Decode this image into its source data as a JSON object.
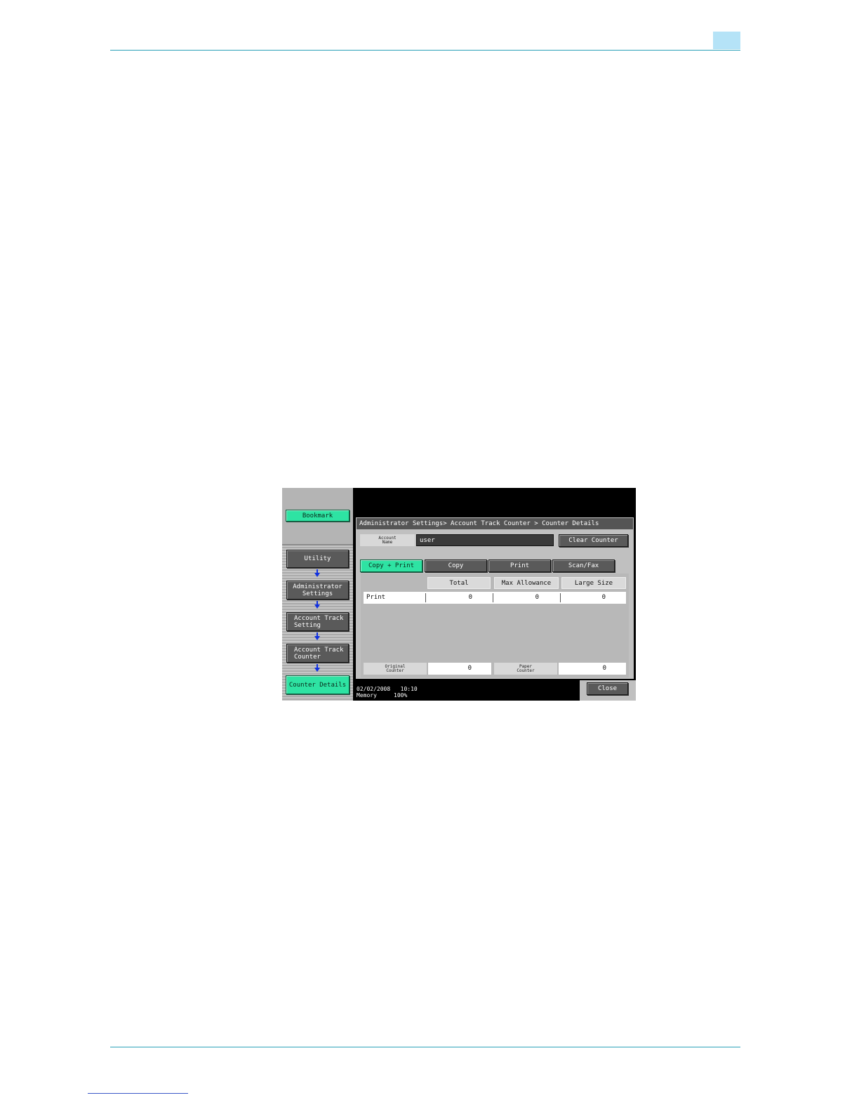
{
  "screen": {
    "sidebar": {
      "bookmark_label": "Bookmark",
      "utility_label": "Utility",
      "admin_settings_label": "Administrator\nSettings",
      "account_track_setting_label": "Account Track\nSetting",
      "account_track_counter_label": "Account Track\nCounter",
      "counter_details_label": "Counter Details"
    },
    "breadcrumb": "Administrator Settings> Account Track Counter > Counter Details",
    "account": {
      "name_label": "Account\nName",
      "name_value": "user",
      "clear_counter_label": "Clear Counter"
    },
    "tabs": [
      {
        "label": "Copy + Print",
        "active": true
      },
      {
        "label": "Copy",
        "active": false
      },
      {
        "label": "Print",
        "active": false
      },
      {
        "label": "Scan/Fax",
        "active": false
      }
    ],
    "table": {
      "headers": [
        "Total",
        "Max Allowance",
        "Large Size"
      ],
      "rows": [
        {
          "label": "Print",
          "total": "0",
          "max_allowance": "0",
          "large_size": "0"
        }
      ]
    },
    "original_counter": {
      "label": "Original\nCounter",
      "value": "0"
    },
    "paper_counter": {
      "label": "Paper\nCounter",
      "value": "0"
    },
    "status": {
      "date": "02/02/2008",
      "time": "10:10",
      "memory_label": "Memory",
      "memory_value": "100%"
    },
    "close_label": "Close"
  },
  "colors": {
    "accent_green": "#2ee3a3",
    "rule_teal": "#2aa0b8",
    "corner_tab": "#b5e3f7"
  }
}
